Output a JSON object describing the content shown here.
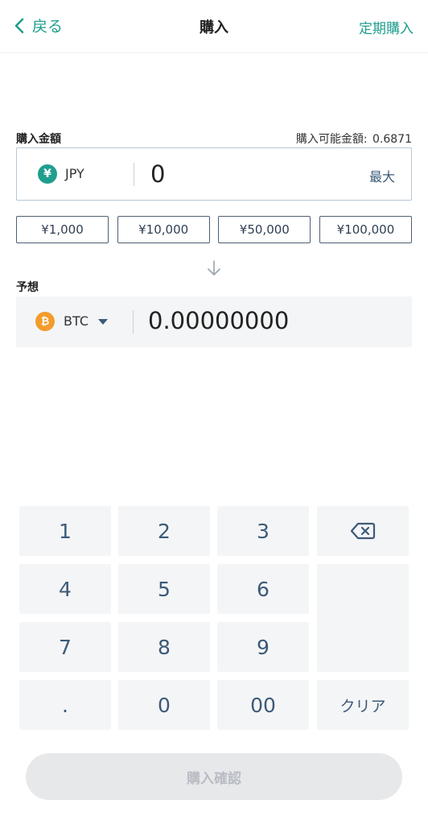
{
  "header": {
    "back_label": "戻る",
    "title": "購入",
    "right_link": "定期購入"
  },
  "purchase": {
    "label": "購入金額",
    "available_label": "購入可能金額:",
    "available_value": "0.6871",
    "currency": "JPY",
    "currency_symbol": "¥",
    "amount": "0",
    "max_label": "最大"
  },
  "quick_amounts": [
    "¥1,000",
    "¥10,000",
    "¥50,000",
    "¥100,000"
  ],
  "estimate": {
    "label": "予想",
    "currency": "BTC",
    "currency_symbol": "₿",
    "amount": "0.00000000"
  },
  "keypad": {
    "k1": "1",
    "k2": "2",
    "k3": "3",
    "k4": "4",
    "k5": "5",
    "k6": "6",
    "k7": "7",
    "k8": "8",
    "k9": "9",
    "dot": ".",
    "k0": "0",
    "k00": "00",
    "clear": "クリア"
  },
  "confirm_label": "購入確認",
  "colors": {
    "accent": "#1f9e8e",
    "btc": "#f39c2b",
    "key_text": "#3c5a78",
    "disabled_bg": "#e7e8ea"
  }
}
